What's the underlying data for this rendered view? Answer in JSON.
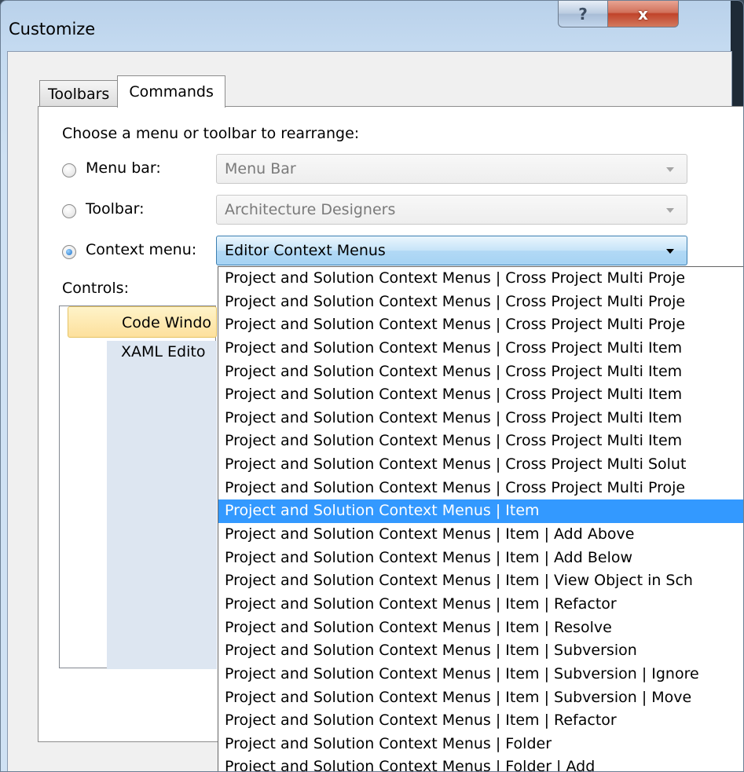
{
  "window": {
    "title": "Customize",
    "help_label": "?",
    "close_label": "x"
  },
  "tabs": [
    {
      "label": "Toolbars",
      "active": false
    },
    {
      "label": "Commands",
      "active": true
    }
  ],
  "commands": {
    "choose_label": "Choose a menu or toolbar to rearrange:",
    "menu_bar": {
      "label": "Menu bar:",
      "value": "Menu Bar",
      "selected": false
    },
    "toolbar": {
      "label": "Toolbar:",
      "value": "Architecture Designers",
      "selected": false
    },
    "context_menu": {
      "label": "Context menu:",
      "value": "Editor Context Menus",
      "selected": true
    },
    "controls_label": "Controls:",
    "controls_items": [
      "Code Window",
      "XAML Editor"
    ],
    "controls_items_visible": [
      "Code Windo",
      "XAML Edito"
    ]
  },
  "dropdown_items": [
    "Project and Solution Context Menus | Cross Project Multi Proje",
    "Project and Solution Context Menus | Cross Project Multi Proje",
    "Project and Solution Context Menus | Cross Project Multi Proje",
    "Project and Solution Context Menus | Cross Project Multi Item",
    "Project and Solution Context Menus | Cross Project Multi Item",
    "Project and Solution Context Menus | Cross Project Multi Item",
    "Project and Solution Context Menus | Cross Project Multi Item",
    "Project and Solution Context Menus | Cross Project Multi Item",
    "Project and Solution Context Menus | Cross Project Multi Solut",
    "Project and Solution Context Menus | Cross Project Multi Proje",
    "Project and Solution Context Menus | Item",
    "Project and Solution Context Menus | Item | Add Above",
    "Project and Solution Context Menus | Item | Add Below",
    "Project and Solution Context Menus | Item | View Object in Sch",
    "Project and Solution Context Menus | Item | Refactor",
    "Project and Solution Context Menus | Item | Resolve",
    "Project and Solution Context Menus | Item | Subversion",
    "Project and Solution Context Menus | Item | Subversion | Ignore",
    "Project and Solution Context Menus | Item | Subversion | Move",
    "Project and Solution Context Menus | Item | Refactor",
    "Project and Solution Context Menus | Folder",
    "Project and Solution Context Menus | Folder | Add"
  ],
  "dropdown_selected_index": 10,
  "colors": {
    "selection": "#3399ff",
    "control_highlight": "#fde09c"
  }
}
